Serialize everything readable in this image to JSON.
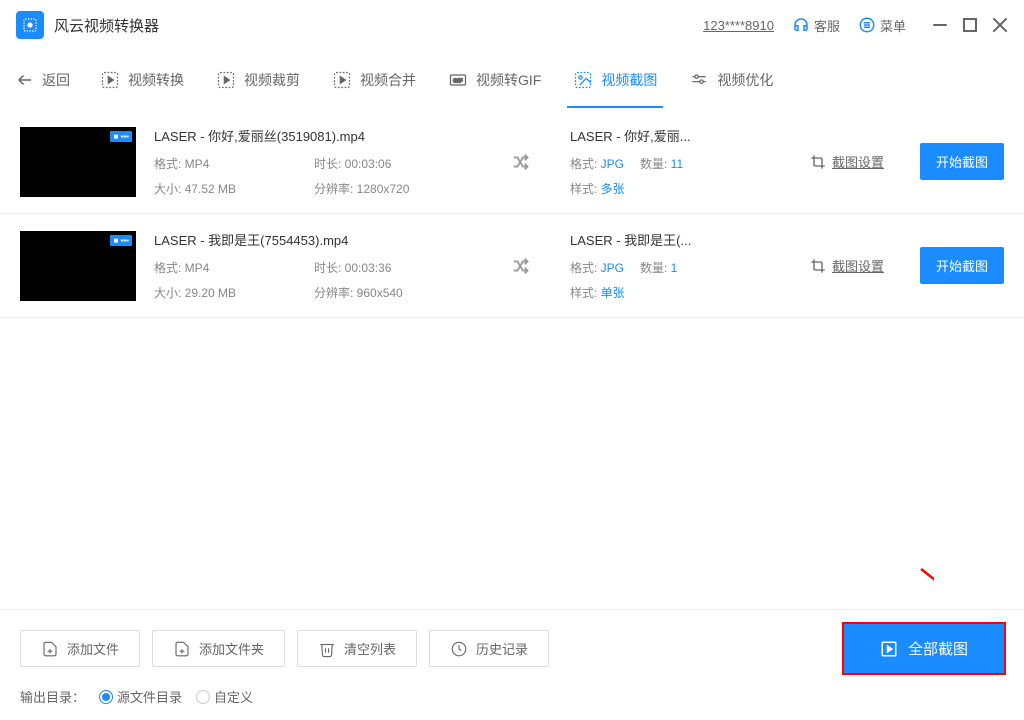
{
  "titlebar": {
    "app_title": "风云视频转换器",
    "user_id": "123****8910",
    "support": "客服",
    "menu": "菜单"
  },
  "nav": {
    "back": "返回",
    "tabs": [
      "视频转换",
      "视频裁剪",
      "视频合并",
      "视频转GIF",
      "视频截图",
      "视频优化"
    ]
  },
  "items": [
    {
      "filename": "LASER - 你好,爱丽丝(3519081).mp4",
      "format_lbl": "格式:",
      "format": "MP4",
      "duration_lbl": "时长:",
      "duration": "00:03:06",
      "size_lbl": "大小:",
      "size": "47.52 MB",
      "res_lbl": "分辨率:",
      "res": "1280x720",
      "out_name": "LASER - 你好,爱丽...",
      "out_format_lbl": "格式:",
      "out_format": "JPG",
      "count_lbl": "数量:",
      "count": "11",
      "style_lbl": "样式:",
      "style": "多张",
      "settings": "截图设置",
      "start": "开始截图"
    },
    {
      "filename": "LASER - 我即是王(7554453).mp4",
      "format_lbl": "格式:",
      "format": "MP4",
      "duration_lbl": "时长:",
      "duration": "00:03:36",
      "size_lbl": "大小:",
      "size": "29.20 MB",
      "res_lbl": "分辨率:",
      "res": "960x540",
      "out_name": "LASER - 我即是王(...",
      "out_format_lbl": "格式:",
      "out_format": "JPG",
      "count_lbl": "数量:",
      "count": "1",
      "style_lbl": "样式:",
      "style": "单张",
      "settings": "截图设置",
      "start": "开始截图"
    }
  ],
  "footer": {
    "add_file": "添加文件",
    "add_folder": "添加文件夹",
    "clear": "清空列表",
    "history": "历史记录",
    "all": "全部截图",
    "out_dir_lbl": "输出目录：",
    "radio_source": "源文件目录",
    "radio_custom": "自定义"
  }
}
